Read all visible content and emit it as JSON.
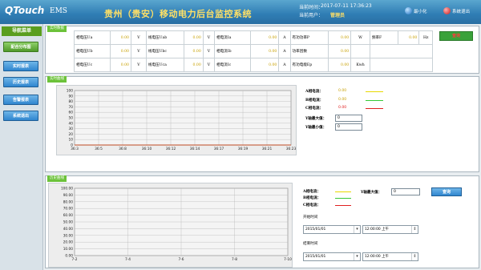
{
  "header": {
    "logo_brand": "QTouch",
    "logo_product": "EMS",
    "title": "贵州（贵安）移动电力后台监控系统",
    "time_label": "当前时间：",
    "time_value": "2017-07-11 17:36:23",
    "user_label": "当前用户：",
    "user_value": "管理员",
    "minimize_label": "最小化",
    "exit_label": "系统退出"
  },
  "sidebar": {
    "title": "导航菜单",
    "items": [
      {
        "label": "配合分布图",
        "active": true
      },
      {
        "label": "实时报表",
        "active": false
      },
      {
        "label": "历史报表",
        "active": false
      },
      {
        "label": "告警报表",
        "active": false
      },
      {
        "label": "系统退出",
        "active": false
      }
    ]
  },
  "metrics": {
    "tag": "实时数据",
    "rows": [
      {
        "c1": "相电压Ua",
        "v1": "0.00",
        "u1": "V",
        "c2": "线电压Uab",
        "v2": "0.00",
        "u2": "V",
        "c3": "相电流Ia",
        "v3": "0.00",
        "u3": "A",
        "c4": "有功功率P",
        "v4": "0.00",
        "u4": "W",
        "c5": "频率F",
        "v5": "0.00",
        "u5": "Hz"
      },
      {
        "c1": "相电压Ub",
        "v1": "0.00",
        "u1": "V",
        "c2": "线电压Ubc",
        "v2": "0.00",
        "u2": "V",
        "c3": "相电流Ib",
        "v3": "0.00",
        "u3": "A",
        "c4": "功率因数",
        "v4": "0.00",
        "u4": ""
      },
      {
        "c1": "相电压Uc",
        "v1": "0.00",
        "u1": "V",
        "c2": "线电压Uca",
        "v2": "0.00",
        "u2": "V",
        "c3": "相电流Ic",
        "v3": "0.00",
        "u3": "A",
        "c4": "有功电能Ep",
        "v4": "0.00",
        "u4": "Kwh"
      }
    ],
    "query_label": "查询"
  },
  "realtime": {
    "tag": "实时曲线",
    "legend": [
      {
        "label": "A相电流：",
        "value": "0.00",
        "color": "#e8d800"
      },
      {
        "label": "B相电流：",
        "value": "0.00",
        "color": "#37c837"
      },
      {
        "label": "C相电流：",
        "value": "0.00",
        "color": "#e02020"
      }
    ],
    "ymax_label": "Y轴最大值：",
    "ymax_value": "0",
    "ymin_label": "Y轴最小值：",
    "ymin_value": "0"
  },
  "history": {
    "tag": "历史曲线",
    "legend": [
      {
        "label": "A相电流：",
        "color": "#e8d800"
      },
      {
        "label": "B相电流：",
        "color": "#37c837"
      },
      {
        "label": "C相电流：",
        "color": "#e02020"
      }
    ],
    "ymax_label": "Y轴最大值：",
    "ymax_value": "0",
    "query_label": "查询",
    "start_label": "开始时间",
    "start_date": "2015/01/01",
    "start_time": "12:00:00 上午",
    "end_label": "结束时间",
    "end_date": "2015/01/01",
    "end_time": "12:00:00 上午"
  },
  "chart_data": [
    {
      "type": "line",
      "title": "",
      "x": [
        "36:3",
        "36:5",
        "36:8",
        "36:10",
        "36:12",
        "36:14",
        "36:17",
        "36:19",
        "36:21",
        "36:23"
      ],
      "y_ticks": [
        0,
        10,
        20,
        30,
        40,
        50,
        60,
        70,
        80,
        90,
        100
      ],
      "ylim": [
        0,
        100
      ],
      "series": [
        {
          "color": "#e8d800",
          "values": [
            0,
            0,
            0,
            0,
            0,
            0,
            0,
            0,
            0,
            0
          ]
        },
        {
          "color": "#37c837",
          "values": [
            0,
            0,
            0,
            0,
            0,
            0,
            0,
            0,
            0,
            0
          ]
        },
        {
          "color": "#e02020",
          "values": [
            0,
            0,
            0,
            0,
            0,
            0,
            0,
            0,
            0,
            0
          ]
        }
      ],
      "grid": true
    },
    {
      "type": "line",
      "title": "",
      "x": [
        "7-2",
        "7-4",
        "7-6",
        "7-8",
        "7-10"
      ],
      "y_ticks": [
        "0.00",
        "10.00",
        "20.00",
        "30.00",
        "40.00",
        "50.00",
        "60.00",
        "70.00",
        "80.00",
        "90.00",
        "100.00"
      ],
      "ylim": [
        0,
        100
      ],
      "series": [],
      "grid": true
    }
  ]
}
